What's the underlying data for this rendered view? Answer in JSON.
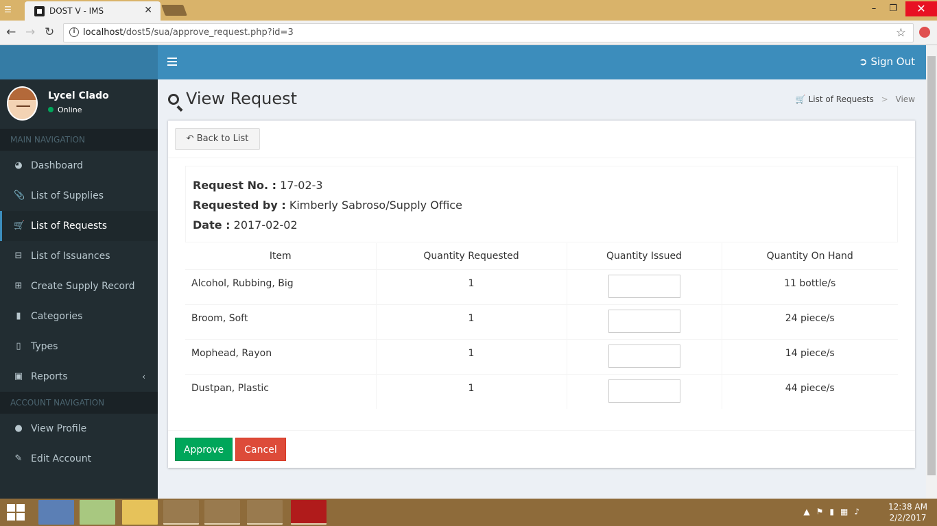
{
  "browser": {
    "tab_title": "DOST V - IMS",
    "url_host": "localhost",
    "url_path": "/dost5/sua/approve_request.php?id=3"
  },
  "sidebar": {
    "user_name": "Lycel Clado",
    "user_status": "Online",
    "main_nav_header": "MAIN NAVIGATION",
    "main_items": [
      {
        "label": "Dashboard",
        "icon": "dashboard-icon"
      },
      {
        "label": "List of Supplies",
        "icon": "paperclip-icon"
      },
      {
        "label": "List of Requests",
        "icon": "cart-icon",
        "active": true
      },
      {
        "label": "List of Issuances",
        "icon": "minus-square-icon"
      },
      {
        "label": "Create Supply Record",
        "icon": "plus-square-icon"
      },
      {
        "label": "Categories",
        "icon": "folder-icon"
      },
      {
        "label": "Types",
        "icon": "folder-open-icon"
      },
      {
        "label": "Reports",
        "icon": "file-icon"
      }
    ],
    "account_nav_header": "ACCOUNT NAVIGATION",
    "account_items": [
      {
        "label": "View Profile",
        "icon": "user-icon"
      },
      {
        "label": "Edit Account",
        "icon": "edit-icon"
      }
    ]
  },
  "topbar": {
    "sign_out": "Sign Out"
  },
  "page": {
    "title": "View Request",
    "breadcrumb": [
      "List of Requests",
      "View"
    ]
  },
  "request": {
    "back_label": "Back to List",
    "request_no_label": "Request No. :",
    "request_no": "17-02-3",
    "requested_by_label": "Requested by :",
    "requested_by": "Kimberly Sabroso/Supply Office",
    "date_label": "Date :",
    "date": "2017-02-02",
    "columns": [
      "Item",
      "Quantity Requested",
      "Quantity Issued",
      "Quantity On Hand"
    ],
    "items": [
      {
        "item": "Alcohol, Rubbing, Big",
        "requested": "1",
        "issued": "",
        "on_hand": "11 bottle/s"
      },
      {
        "item": "Broom, Soft",
        "requested": "1",
        "issued": "",
        "on_hand": "24 piece/s"
      },
      {
        "item": "Mophead, Rayon",
        "requested": "1",
        "issued": "",
        "on_hand": "14 piece/s"
      },
      {
        "item": "Dustpan, Plastic",
        "requested": "1",
        "issued": "",
        "on_hand": "44 piece/s"
      }
    ],
    "approve_label": "Approve",
    "cancel_label": "Cancel"
  },
  "taskbar": {
    "time": "12:38 AM",
    "date": "2/2/2017"
  },
  "colors": {
    "sidebar_bg": "#222d32",
    "topbar_bg": "#3c8dbc",
    "approve": "#00a65a",
    "cancel": "#dd4b39"
  }
}
